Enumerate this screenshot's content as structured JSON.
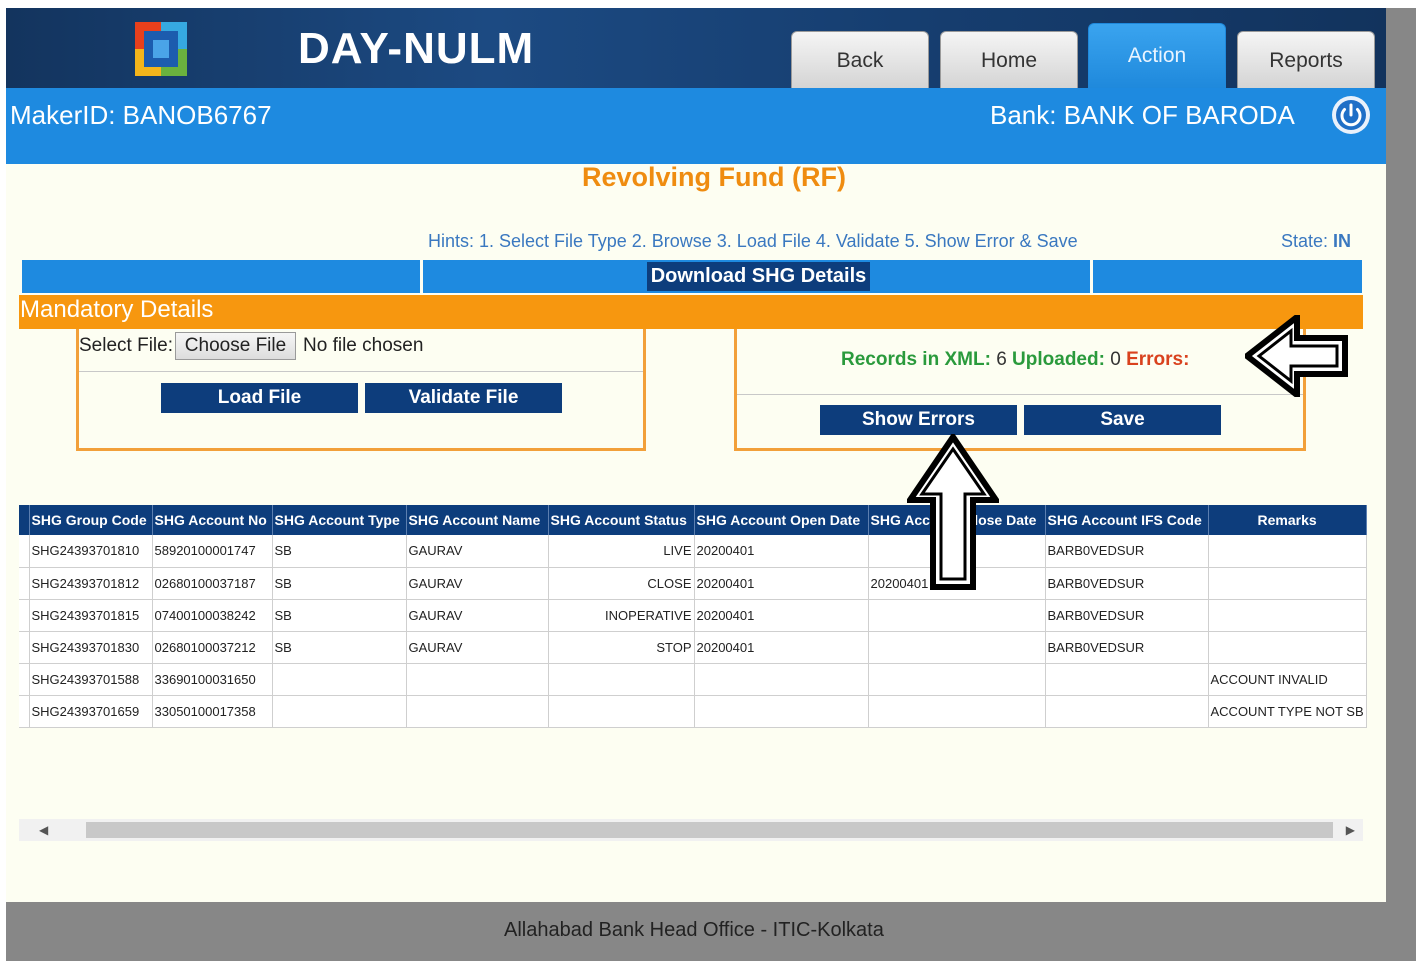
{
  "header": {
    "app_title": "DAY-NULM",
    "logo_icon": "day-nulm-logo",
    "nav": [
      {
        "label": "Back"
      },
      {
        "label": "Home"
      },
      {
        "label": "Action",
        "active": true
      },
      {
        "label": "Reports"
      }
    ],
    "maker_id": "MakerID: BANOB6767",
    "bank": "Bank: BANK OF BARODA",
    "power_icon": "power-icon"
  },
  "page": {
    "title": "Revolving Fund (RF)",
    "hints": "Hints: 1. Select File Type 2. Browse 3. Load File 4. Validate 5. Show Error & Save",
    "state_label": "State:",
    "state_value": "IN",
    "download_button": "Download SHG Details",
    "mandatory_title": "Mandatory Details"
  },
  "upload": {
    "select_file_label": "Select File:",
    "choose_file_button": "Choose File",
    "no_file_text": "No file chosen",
    "load_button": "Load File",
    "validate_button": "Validate File"
  },
  "records": {
    "in_xml_label": "Records in XML:",
    "in_xml_value": "6",
    "uploaded_label": "Uploaded:",
    "uploaded_value": "0",
    "errors_label": "Errors:",
    "show_errors_button": "Show Errors",
    "save_button": "Save"
  },
  "table": {
    "columns": [
      "SHG Group Code",
      "SHG Account No",
      "SHG Account Type",
      "SHG Account Name",
      "SHG Account Status",
      "SHG Account Open Date",
      "SHG Account Close Date",
      "SHG Account IFS Code",
      "Remarks"
    ],
    "rows": [
      [
        "SHG24393701810",
        "58920100001747",
        "SB",
        "GAURAV",
        "LIVE",
        "20200401",
        "",
        "BARB0VEDSUR",
        ""
      ],
      [
        "SHG24393701812",
        "02680100037187",
        "SB",
        "GAURAV",
        "CLOSE",
        "20200401",
        "20200401",
        "BARB0VEDSUR",
        ""
      ],
      [
        "SHG24393701815",
        "07400100038242",
        "SB",
        "GAURAV",
        "INOPERATIVE",
        "20200401",
        "",
        "BARB0VEDSUR",
        ""
      ],
      [
        "SHG24393701830",
        "02680100037212",
        "SB",
        "GAURAV",
        "STOP",
        "20200401",
        "",
        "BARB0VEDSUR",
        ""
      ],
      [
        "SHG24393701588",
        "33690100031650",
        "",
        "",
        "",
        "",
        "",
        "",
        "ACCOUNT INVALID"
      ],
      [
        "SHG24393701659",
        "33050100017358",
        "",
        "",
        "",
        "",
        "",
        "",
        "ACCOUNT TYPE NOT SB"
      ]
    ]
  },
  "footer": {
    "text": "Allahabad Bank Head Office - ITIC-Kolkata"
  },
  "annotations": {
    "left_arrow_icon": "left-arrow-icon",
    "up_arrow_icon": "up-arrow-icon"
  }
}
